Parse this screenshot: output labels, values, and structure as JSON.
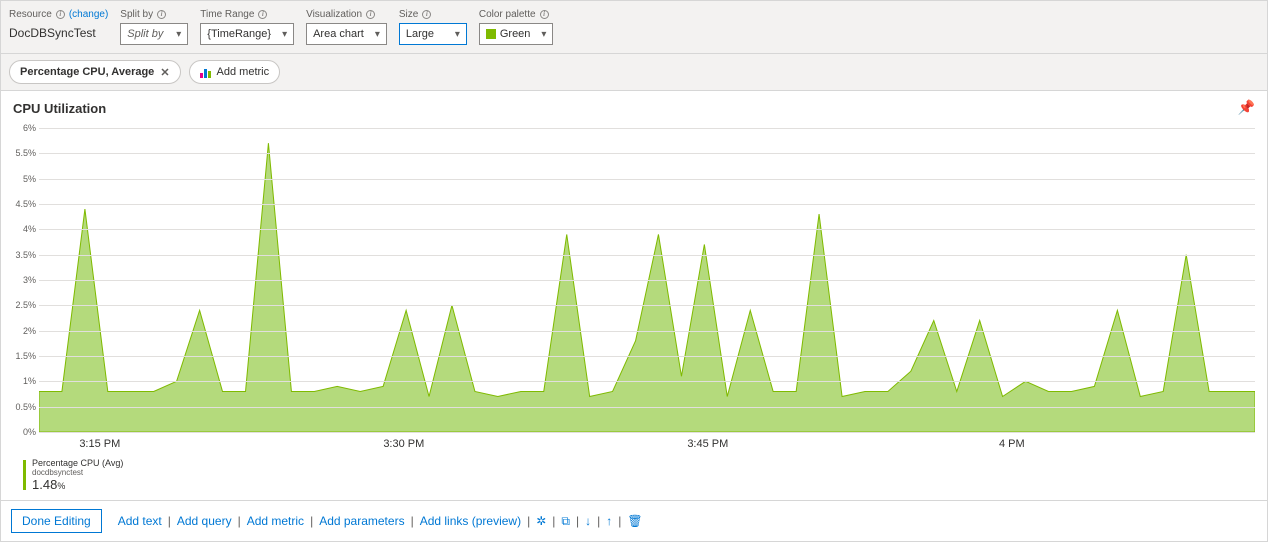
{
  "labels": {
    "resource": "Resource",
    "change": "(change)",
    "splitBy": "Split by",
    "timeRange": "Time Range",
    "visualization": "Visualization",
    "size": "Size",
    "palette": "Color palette"
  },
  "values": {
    "resource": "DocDBSyncTest",
    "splitBy": "Split by",
    "timeRange": "{TimeRange}",
    "visualization": "Area chart",
    "size": "Large",
    "palette": "Green"
  },
  "pills": {
    "metric": "Percentage CPU, Average",
    "addMetric": "Add metric"
  },
  "chart": {
    "title": "CPU Utilization",
    "legend_name": "Percentage CPU (Avg)",
    "legend_sub": "docdbsynctest",
    "legend_value": "1.48",
    "legend_unit": "%"
  },
  "chart_data": {
    "type": "area",
    "ylabel": "",
    "xlabel": "",
    "ylim": [
      0,
      6
    ],
    "yticks": [
      "6%",
      "5.5%",
      "5%",
      "4.5%",
      "4%",
      "3.5%",
      "3%",
      "2.5%",
      "2%",
      "1.5%",
      "1%",
      "0.5%",
      "0%"
    ],
    "xticks": [
      "3:15 PM",
      "3:30 PM",
      "3:45 PM",
      "4 PM"
    ],
    "xtick_pos_pct": [
      5,
      30,
      55,
      80
    ],
    "series": [
      {
        "name": "Percentage CPU (Avg)",
        "color": "#9bcd50",
        "values": [
          0.8,
          0.8,
          4.4,
          0.8,
          0.8,
          0.8,
          1.0,
          2.4,
          0.8,
          0.8,
          5.7,
          0.8,
          0.8,
          0.9,
          0.8,
          0.9,
          2.4,
          0.7,
          2.5,
          0.8,
          0.7,
          0.8,
          0.8,
          3.9,
          0.7,
          0.8,
          1.8,
          3.9,
          1.1,
          3.7,
          0.7,
          2.4,
          0.8,
          0.8,
          4.3,
          0.7,
          0.8,
          0.8,
          1.2,
          2.2,
          0.8,
          2.2,
          0.7,
          1.0,
          0.8,
          0.8,
          0.9,
          2.4,
          0.7,
          0.8,
          3.5,
          0.8,
          0.8,
          0.8
        ]
      }
    ]
  },
  "footer": {
    "done": "Done Editing",
    "addText": "Add text",
    "addQuery": "Add query",
    "addMetric": "Add metric",
    "addParams": "Add parameters",
    "addLinks": "Add links (preview)"
  }
}
